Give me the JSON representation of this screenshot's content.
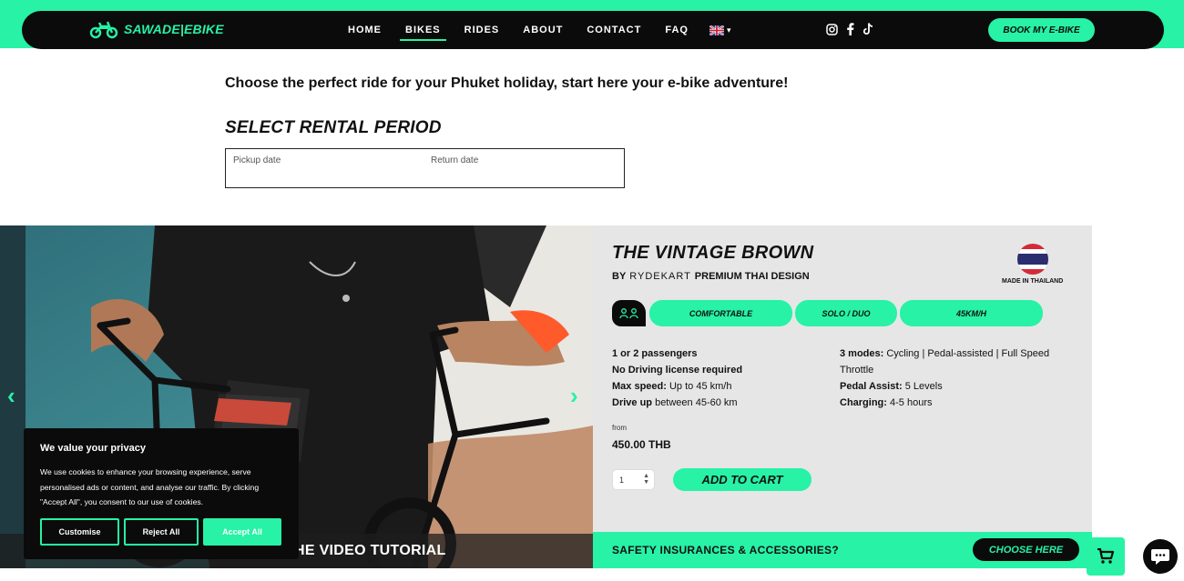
{
  "header": {
    "logo_text": "SAWADE|EBIKE",
    "nav": [
      {
        "label": "HOME"
      },
      {
        "label": "BIKES",
        "active": true
      },
      {
        "label": "RIDES"
      },
      {
        "label": "ABOUT"
      },
      {
        "label": "CONTACT"
      },
      {
        "label": "FAQ"
      }
    ],
    "language_icon": "uk-flag-icon",
    "socials": [
      "instagram-icon",
      "facebook-icon",
      "tiktok-icon"
    ],
    "book_button": "BOOK MY E-BIKE"
  },
  "intro_text": "Choose the perfect ride for your Phuket holiday, start here your e-bike adventure!",
  "rental": {
    "title": "SELECT RENTAL PERIOD",
    "pickup_label": "Pickup date",
    "return_label": "Return date"
  },
  "hero": {
    "video_caption": "HE VIDEO TUTORIAL"
  },
  "product": {
    "title": "THE VINTAGE BROWN",
    "by": "BY",
    "brand": "RYDEKART",
    "design": "PREMIUM THAI DESIGN",
    "made_in": "MADE IN THAILAND",
    "tags": [
      "COMFORTABLE",
      "SOLO / DUO",
      "45KM/H"
    ],
    "specs_left": [
      {
        "bold": "1 or 2 passengers",
        "text": ""
      },
      {
        "bold": "No Driving license required",
        "text": ""
      },
      {
        "bold": "Max speed:",
        "text": " Up to 45 km/h"
      },
      {
        "bold": "Drive up",
        "text": " between 45-60 km"
      }
    ],
    "specs_right": [
      {
        "bold": "3 modes:",
        "text": " Cycling | Pedal-assisted | Full Speed"
      },
      {
        "bold": "",
        "text": "Throttle"
      },
      {
        "bold": "Pedal Assist:",
        "text": " 5 Levels"
      },
      {
        "bold": "Charging:",
        "text": " 4-5 hours"
      }
    ],
    "from_label": "from",
    "price": "450.00 THB",
    "quantity": "1",
    "add_to_cart": "ADD TO CART"
  },
  "safety": {
    "text": "SAFETY INSURANCES & ACCESSORIES?",
    "button": "CHOOSE HERE"
  },
  "cookie": {
    "title": "We value your privacy",
    "body": "We use cookies to enhance your browsing experience, serve personalised ads or content, and analyse our traffic. By clicking \"Accept All\", you consent to our use of cookies.",
    "customise": "Customise",
    "reject": "Reject All",
    "accept": "Accept All"
  },
  "colors": {
    "accent": "#27f2a6",
    "dark": "#0b0b0b",
    "panel": "#e6e6e6"
  }
}
